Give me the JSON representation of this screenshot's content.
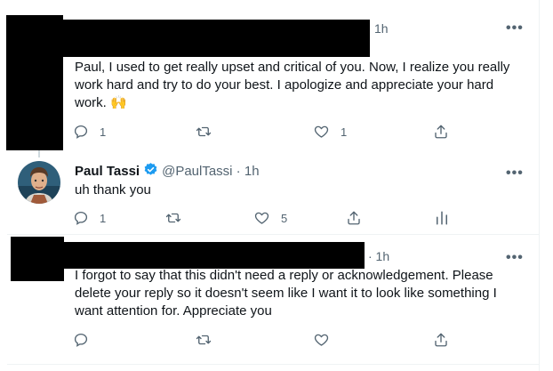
{
  "colors": {
    "text": "#0f1419",
    "muted": "#536471",
    "verified": "#1d9bf0",
    "thread_line": "#cfd9de"
  },
  "tweet1": {
    "time": "1h",
    "more": "•••",
    "text": "Paul, I used to get really upset and critical of you. Now, I realize you really work hard and try to do your best. I apologize and appreciate your hard work. 🙌",
    "reply_count": "1",
    "retweet_count": "",
    "like_count": "1"
  },
  "tweet2": {
    "name": "Paul Tassi",
    "handle_time": "@PaulTassi · 1h",
    "more": "•••",
    "text": "uh thank you",
    "reply_count": "1",
    "retweet_count": "",
    "like_count": "5"
  },
  "tweet3": {
    "time": "· 1h",
    "more": "•••",
    "text": "I forgot to say that this didn't need a reply or acknowledgement. Please delete your reply so it doesn't seem like I want it to look like something I want attention for. Appreciate you",
    "reply_count": "",
    "retweet_count": "",
    "like_count": ""
  }
}
